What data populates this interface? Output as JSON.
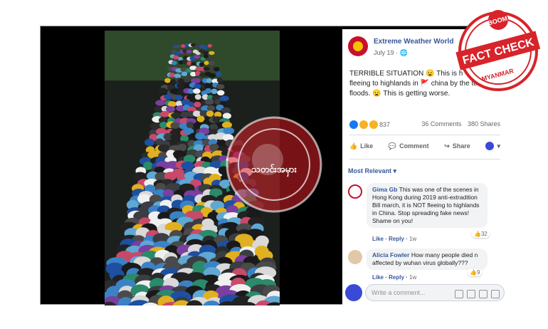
{
  "post": {
    "page_name": "Extreme Weather World",
    "date": "July 19 · ",
    "text_line1": "TERRIBLE SITUATION 😦 This is h",
    "text_line2": "fleeing to highlands in 🚩 china by the te",
    "text_line3": "floods. 😦 This is getting worse.",
    "reaction_count": "837",
    "comments_count": "36 Comments",
    "shares_count": "380 Shares"
  },
  "actions": {
    "like": "Like",
    "comment": "Comment",
    "share": "Share"
  },
  "sort_label": "Most Relevant ▾",
  "comments": [
    {
      "author": "Gima Gb",
      "text": "This was one of the scenes in Hong Kong during 2019 anti-extradition Bill march, it is NOT fleeing to highlands in China. Stop spreading fake news! Shame on you!",
      "like": "Like",
      "reply": "Reply",
      "time": "1w",
      "reactions": "32"
    },
    {
      "author": "Alicia Fowler",
      "text": "How many people died n affected by wuhan virus globally???",
      "like": "Like",
      "reply": "Reply",
      "time": "1w",
      "reactions": "9"
    }
  ],
  "write_placeholder": "Write a comment...",
  "stamp": {
    "top": "BOOM",
    "main": "FACT CHECK",
    "bottom": "MYANMAR"
  },
  "watermark_text": "သတင်းအမှား",
  "colors": {
    "fb_blue": "#385898",
    "stamp_red": "#d8232a"
  }
}
